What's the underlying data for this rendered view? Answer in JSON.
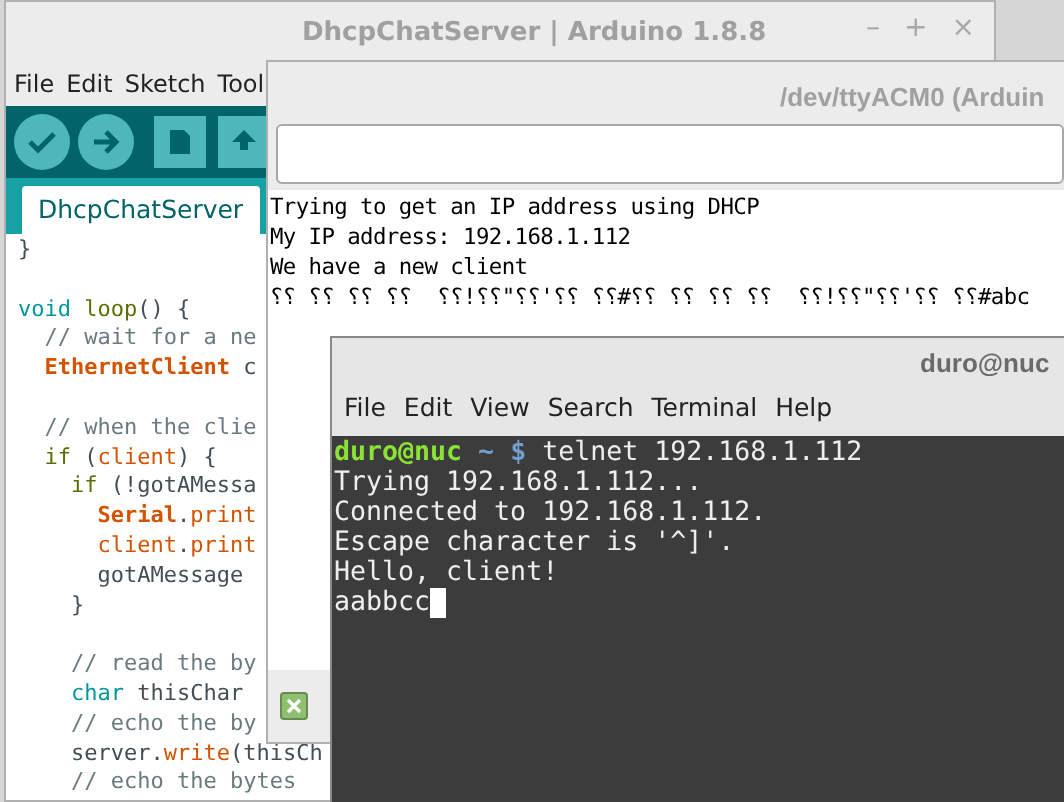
{
  "editor": {
    "title": "DhcpChatServer | Arduino 1.8.8",
    "window_controls": [
      "–",
      "+",
      "×"
    ],
    "menu": [
      "File",
      "Edit",
      "Sketch",
      "Tool"
    ],
    "tabs": [
      {
        "label": "DhcpChatServer",
        "selected": true
      }
    ],
    "code": [
      {
        "segments": [
          {
            "kind": "plain",
            "text": "}"
          }
        ]
      },
      {
        "blank": true
      },
      {
        "segments": [
          {
            "kind": "keyword",
            "text": "void"
          },
          {
            "kind": "control",
            "text": " loop"
          },
          {
            "kind": "plain",
            "text": "() {"
          }
        ]
      },
      {
        "segments": [
          {
            "kind": "comment",
            "text": "  // wait for a ne"
          }
        ]
      },
      {
        "segments": [
          {
            "kind": "class",
            "text": "  EthernetClient"
          },
          {
            "kind": "plain",
            "text": " c"
          }
        ]
      },
      {
        "blank": true
      },
      {
        "segments": [
          {
            "kind": "comment",
            "text": "  // when the clie"
          }
        ]
      },
      {
        "segments": [
          {
            "kind": "control",
            "text": "  if"
          },
          {
            "kind": "plain",
            "text": " ("
          },
          {
            "kind": "function",
            "text": "client"
          },
          {
            "kind": "plain",
            "text": ") {"
          }
        ]
      },
      {
        "segments": [
          {
            "kind": "control",
            "text": "    if"
          },
          {
            "kind": "plain",
            "text": " (!gotAMessa"
          }
        ]
      },
      {
        "segments": [
          {
            "kind": "class",
            "text": "      Serial"
          },
          {
            "kind": "plain",
            "text": "."
          },
          {
            "kind": "function",
            "text": "print"
          }
        ]
      },
      {
        "segments": [
          {
            "kind": "function",
            "text": "      client"
          },
          {
            "kind": "plain",
            "text": "."
          },
          {
            "kind": "function",
            "text": "print"
          }
        ]
      },
      {
        "segments": [
          {
            "kind": "plain",
            "text": "      gotAMessage"
          }
        ]
      },
      {
        "segments": [
          {
            "kind": "plain",
            "text": "    }"
          }
        ]
      },
      {
        "blank": true
      },
      {
        "segments": [
          {
            "kind": "comment",
            "text": "    // read the by"
          }
        ]
      },
      {
        "segments": [
          {
            "kind": "keyword",
            "text": "    char"
          },
          {
            "kind": "plain",
            "text": " thisChar"
          }
        ]
      },
      {
        "segments": [
          {
            "kind": "comment",
            "text": "    // echo the by"
          }
        ]
      },
      {
        "segments": [
          {
            "kind": "plain",
            "text": "    server."
          },
          {
            "kind": "function",
            "text": "write"
          },
          {
            "kind": "plain",
            "text": "(thisCh"
          }
        ]
      },
      {
        "segments": [
          {
            "kind": "comment",
            "text": "    // echo the bytes"
          }
        ]
      }
    ]
  },
  "serial_monitor": {
    "title": "/dev/ttyACM0 (Arduin",
    "output": [
      "Trying to get an IP address using DHCP",
      "My IP address: 192.168.1.112",
      "We have a new client",
      "⸮⸮ ⸮⸮ ⸮⸮ ⸮⸮  ⸮⸮!⸮⸮\"⸮⸮'⸮⸮ ⸮⸮#⸮⸮ ⸮⸮ ⸮⸮ ⸮⸮  ⸮⸮!⸮⸮\"⸮⸮'⸮⸮ ⸮⸮#abc"
    ],
    "autoscroll": {
      "checked": true
    }
  },
  "terminal": {
    "title": "duro@nuc",
    "menu": [
      "File",
      "Edit",
      "View",
      "Search",
      "Terminal",
      "Help"
    ],
    "lines": [
      [
        {
          "kind": "user",
          "text": "duro@nuc"
        },
        {
          "kind": "path",
          "text": " ~ $"
        },
        {
          "kind": "output",
          "text": " telnet 192.168.1.112"
        }
      ],
      [
        {
          "kind": "output",
          "text": "Trying 192.168.1.112..."
        }
      ],
      [
        {
          "kind": "output",
          "text": "Connected to 192.168.1.112."
        }
      ],
      [
        {
          "kind": "output",
          "text": "Escape character is '^]'."
        }
      ],
      [
        {
          "kind": "output",
          "text": "Hello, client!"
        }
      ],
      [
        {
          "kind": "output",
          "text": "aabbcc"
        }
      ]
    ],
    "cursor": true
  }
}
